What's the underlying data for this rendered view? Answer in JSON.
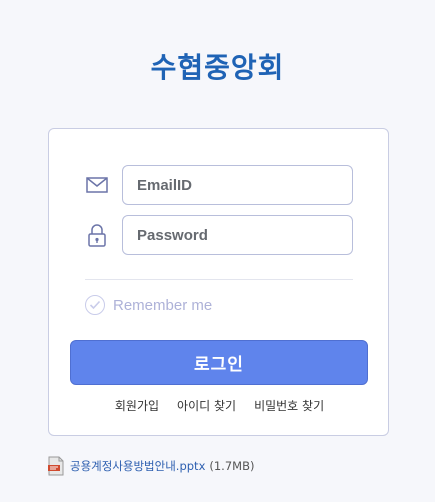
{
  "brand": {
    "title": "수협중앙회"
  },
  "login": {
    "email_placeholder": "EmailID",
    "password_placeholder": "Password",
    "remember_label": "Remember me",
    "submit_label": "로그인"
  },
  "links": {
    "signup": "회원가입",
    "find_id": "아이디 찾기",
    "find_password": "비밀번호 찾기"
  },
  "attachment": {
    "icon": "pptx-file-icon",
    "file_name": "공용계정사용방법안내.pptx",
    "file_size": "(1.7MB)"
  },
  "colors": {
    "brand": "#1f63b5",
    "button": "#5f84ec",
    "link": "#2d5fb0"
  }
}
